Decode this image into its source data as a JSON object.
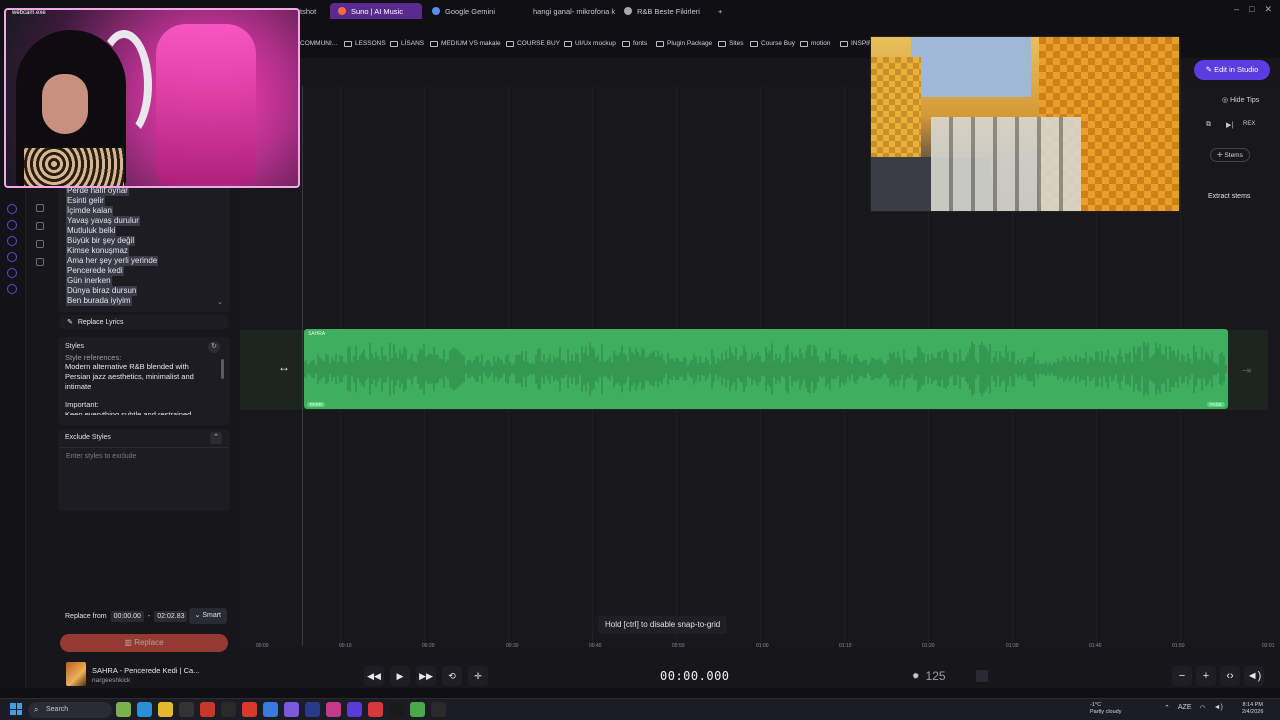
{
  "browser": {
    "tabs": [
      {
        "label": "tshot",
        "active": false,
        "fav_color": "#888"
      },
      {
        "label": "Suno | AI Music",
        "active": true,
        "fav_color": "#ff6a3a"
      },
      {
        "label": "Google Gemini",
        "active": false,
        "fav_color": "#5a8cff"
      },
      {
        "label": "hangi ganal- mikrofona k",
        "active": false,
        "fav_color": "#e03030"
      },
      {
        "label": "R&B Beste Fikirleri",
        "active": false,
        "fav_color": "#aaa"
      }
    ],
    "new_tab": "+",
    "bookmarks": [
      "COMMUNI...",
      "LESSONS",
      "LİSANS",
      "MEDIUM VS makale",
      "COURSE BUY",
      "UI/Ux mockup",
      "fonts",
      "Plugin Package",
      "Sites",
      "Course Buy",
      "motion",
      "INSPIR"
    ]
  },
  "webcam": {
    "title": "webcam.exe"
  },
  "lyrics": {
    "lines": [
      "Perde hafif oynar",
      "Esinti gelir",
      "İçimde kalan",
      "Yavaş yavaş durulur",
      "Mutluluk belki",
      "Büyük bir şey değil",
      "Kimse konuşmaz",
      "Ama her şey yerli yerinde",
      "Pencerede kedi",
      "Gün inerken",
      "Dünya biraz dursun",
      "Ben burada iyiyim"
    ],
    "replace_label": "Replace Lyrics"
  },
  "styles": {
    "title": "Styles",
    "text_cut": "Style references:",
    "text": "Modern alternative R&B blended with Persian jazz aesthetics, minimalist and intimate",
    "important": "Important:",
    "important_cut": "Keep everything subtle and restrained"
  },
  "exclude": {
    "title": "Exclude Styles",
    "placeholder": "Enter styles to exclude"
  },
  "replace_from": {
    "label": "Replace from",
    "start": "00:00.00",
    "dash": "-",
    "end": "02:02.83",
    "mode": "Smart",
    "button": "Replace"
  },
  "now_playing": {
    "title": "SAHRA - Pencerede Kedi | Ca...",
    "artist": "nargeeshkick"
  },
  "track": {
    "label": "SAHRA",
    "tag_left": "PARR",
    "tag_right": "FADE",
    "color": "#3fae5e"
  },
  "snap_tip": "Hold [ctrl] to disable snap-to-grid",
  "ruler": [
    "00:00",
    "00:10",
    "00:20",
    "00:30",
    "00:40",
    "00:50",
    "01:00",
    "01:10",
    "01:20",
    "01:30",
    "01:40",
    "01:50",
    "02:01"
  ],
  "transport": {
    "time": "00:00.000",
    "bpm": "125"
  },
  "right_panel": {
    "edit_studio": "Edit in Studio",
    "hide_tips": "Hide Tips",
    "rex": "REX",
    "stems": "Stems",
    "extract": "Extract stems"
  },
  "taskbar": {
    "search": "Search",
    "weather_temp": "-1°C",
    "weather_desc": "Partly cloudy",
    "lang": "AZE",
    "time": "8:14 PM",
    "date": "2/4/2026"
  }
}
